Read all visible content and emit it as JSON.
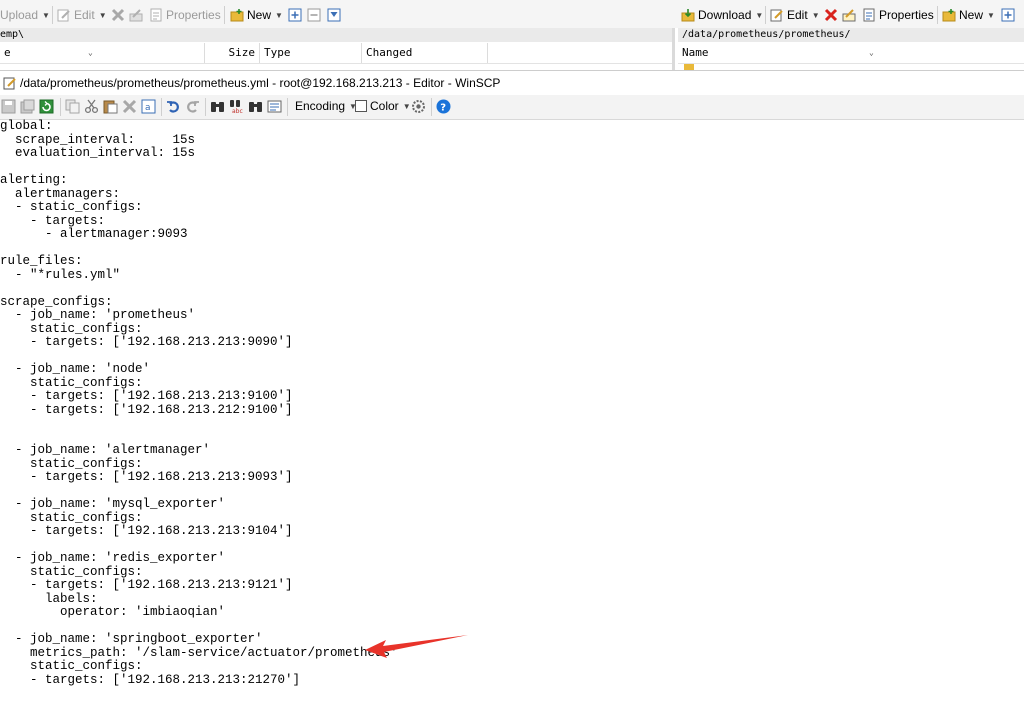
{
  "main_window": {
    "left_toolbar": {
      "upload_label": "Upload",
      "edit_label": "Edit",
      "properties_label": "Properties",
      "new_label": "New"
    },
    "right_toolbar": {
      "download_label": "Download",
      "edit_label": "Edit",
      "properties_label": "Properties",
      "new_label": "New"
    },
    "left_panel": {
      "path": "emp\\",
      "columns": [
        "e",
        "Size",
        "Type",
        "Changed"
      ]
    },
    "right_panel": {
      "path": "/data/prometheus/prometheus/",
      "columns": [
        "Name"
      ]
    }
  },
  "editor": {
    "title": "/data/prometheus/prometheus/prometheus.yml - root@192.168.213.213 - Editor - WinSCP",
    "toolbar": {
      "encoding_label": "Encoding",
      "color_label": "Color",
      "help_label": "?"
    },
    "content": "global:\n  scrape_interval:     15s\n  evaluation_interval: 15s\n\nalerting:\n  alertmanagers:\n  - static_configs:\n    - targets:\n      - alertmanager:9093\n\nrule_files:\n  - \"*rules.yml\"\n\nscrape_configs:\n  - job_name: 'prometheus'\n    static_configs:\n    - targets: ['192.168.213.213:9090']\n\n  - job_name: 'node'\n    static_configs:\n    - targets: ['192.168.213.213:9100']\n    - targets: ['192.168.213.212:9100']\n\n\n  - job_name: 'alertmanager'\n    static_configs:\n    - targets: ['192.168.213.213:9093']\n\n  - job_name: 'mysql_exporter'\n    static_configs:\n    - targets: ['192.168.213.213:9104']\n\n  - job_name: 'redis_exporter'\n    static_configs:\n    - targets: ['192.168.213.213:9121']\n      labels:\n        operator: 'imbiaoqian'\n\n  - job_name: 'springboot_exporter'\n    metrics_path: '/slam-service/actuator/prometheus'\n    static_configs:\n    - targets: ['192.168.213.213:21270']"
  },
  "colors": {
    "annotation_arrow": "#e8332a",
    "help_button": "#1a73d9",
    "delete_icon": "#d9231d",
    "folder_icon": "#e9b93a"
  }
}
